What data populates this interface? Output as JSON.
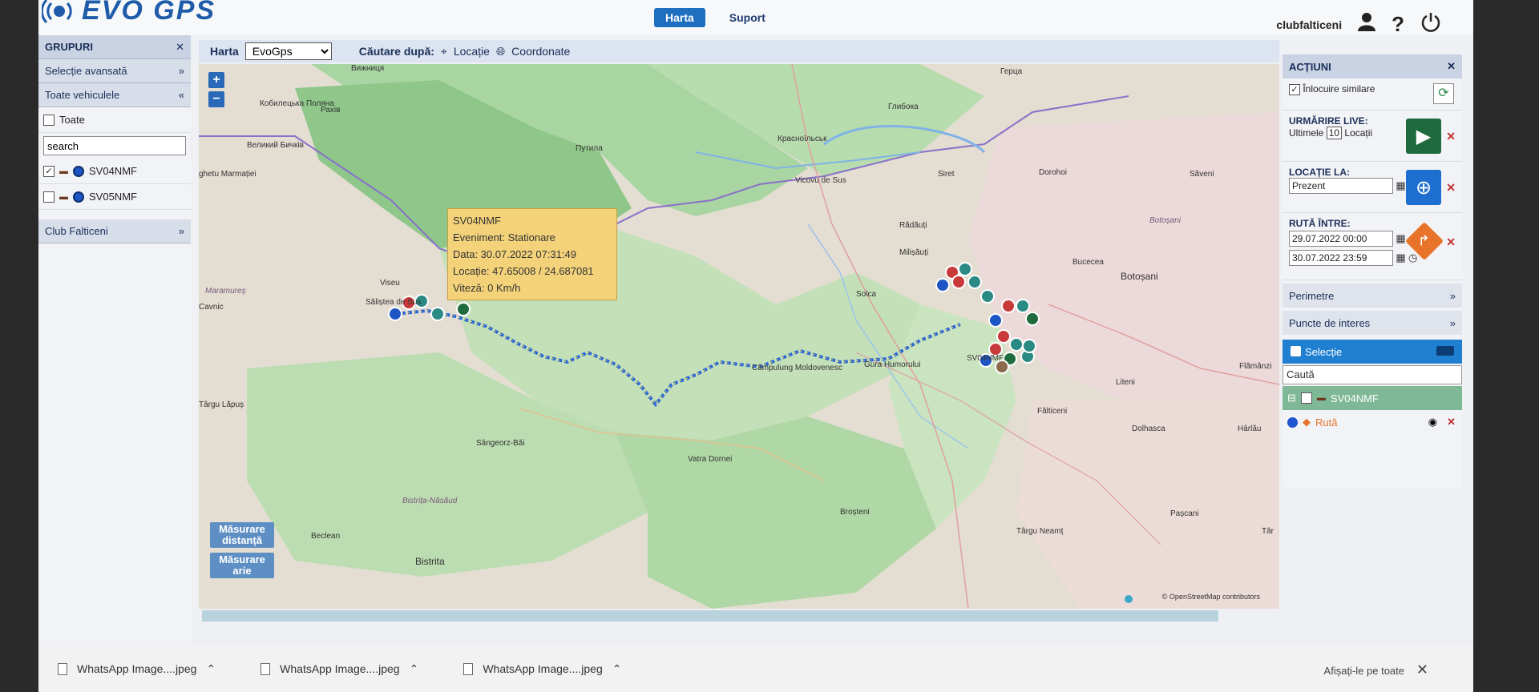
{
  "header": {
    "logo_text": "EVO GPS",
    "nav": [
      "Harta",
      "Suport"
    ],
    "username": "clubfalticeni",
    "help_symbol": "?"
  },
  "left_panel": {
    "groups_title": "GRUPURI",
    "advanced": "Selecție avansată",
    "all_vehicles": "Toate vehiculele",
    "all_label": "Toate",
    "search_value": "search",
    "vehicles": [
      {
        "name": "SV04NMF",
        "checked": true
      },
      {
        "name": "SV05NMF",
        "checked": false
      }
    ],
    "club": "Club Falticeni"
  },
  "map_toolbar": {
    "label": "Harta",
    "selected_map": "EvoGps",
    "search_label": "Căutare după:",
    "opt_location": "Locație",
    "opt_coords": "Coordonate"
  },
  "map": {
    "tooltip": {
      "title": "SV04NMF",
      "event": "Eveniment: Stationare",
      "date": "Data: 30.07.2022 07:31:49",
      "location": "Locație: 47.65008 / 24.687081",
      "speed": "Viteză: 0 Km/h"
    },
    "places": [
      "Кобилецька Поляна",
      "Раxiв",
      "Великий Бичків",
      "ghetu Marmației",
      "Путила",
      "Красноїльськ",
      "Вижниця",
      "Глибока",
      "Герца",
      "Vicovu de Sus",
      "Siret",
      "Rădăuți",
      "Milișăuți",
      "Dorohoi",
      "Săveni",
      "Botoșani",
      "Bucecea",
      "Solca",
      "Viseu",
      "Săliștea de Sus",
      "Maramureș",
      "Cavnic",
      "Târgu Lăpuș",
      "Sângeorz-Băi",
      "Câmpulung Moldovenesc",
      "Gura Humorului",
      "Vatra Dornei",
      "Fălticeni",
      "Liteni",
      "Flămânzi",
      "Dolhasca",
      "Hârlău",
      "Bistrița-Năsăud",
      "Beclean",
      "Bistrita",
      "Broșteni",
      "Târgu Neamț",
      "Pașcani",
      "Târ",
      "SV04NMF"
    ],
    "measure_distance": "Măsurare distanță",
    "measure_area": "Măsurare arie",
    "attribution": "© OpenStreetMap contributors"
  },
  "right_panel": {
    "title": "ACȚIUNI",
    "similar": "Înlocuire similare",
    "live_title": "URMĂRIRE LIVE:",
    "live_last": "Ultimele",
    "live_count": "10",
    "live_unit": "Locații",
    "loc_title": "LOCAȚIE LA:",
    "loc_value": "Prezent",
    "route_title": "RUTĂ ÎNTRE:",
    "route_from": "29.07.2022 00:00",
    "route_to": "30.07.2022 23:59",
    "perimeters": "Perimetre",
    "poi": "Puncte de interes",
    "selection": "Selecție",
    "search_placeholder": "Caută",
    "route_vehicle": "SV04NMF",
    "route_label": "Rută"
  },
  "downloads": {
    "files": [
      "WhatsApp Image....jpeg",
      "WhatsApp Image....jpeg",
      "WhatsApp Image....jpeg"
    ],
    "show_all": "Afișați-le pe toate"
  },
  "colors": {
    "accent": "#1e6fc0",
    "route_line": "#2a66d9",
    "tooltip_bg": "#f3d27a",
    "play_green": "#1f6b3e",
    "route_orange": "#e8742a"
  }
}
